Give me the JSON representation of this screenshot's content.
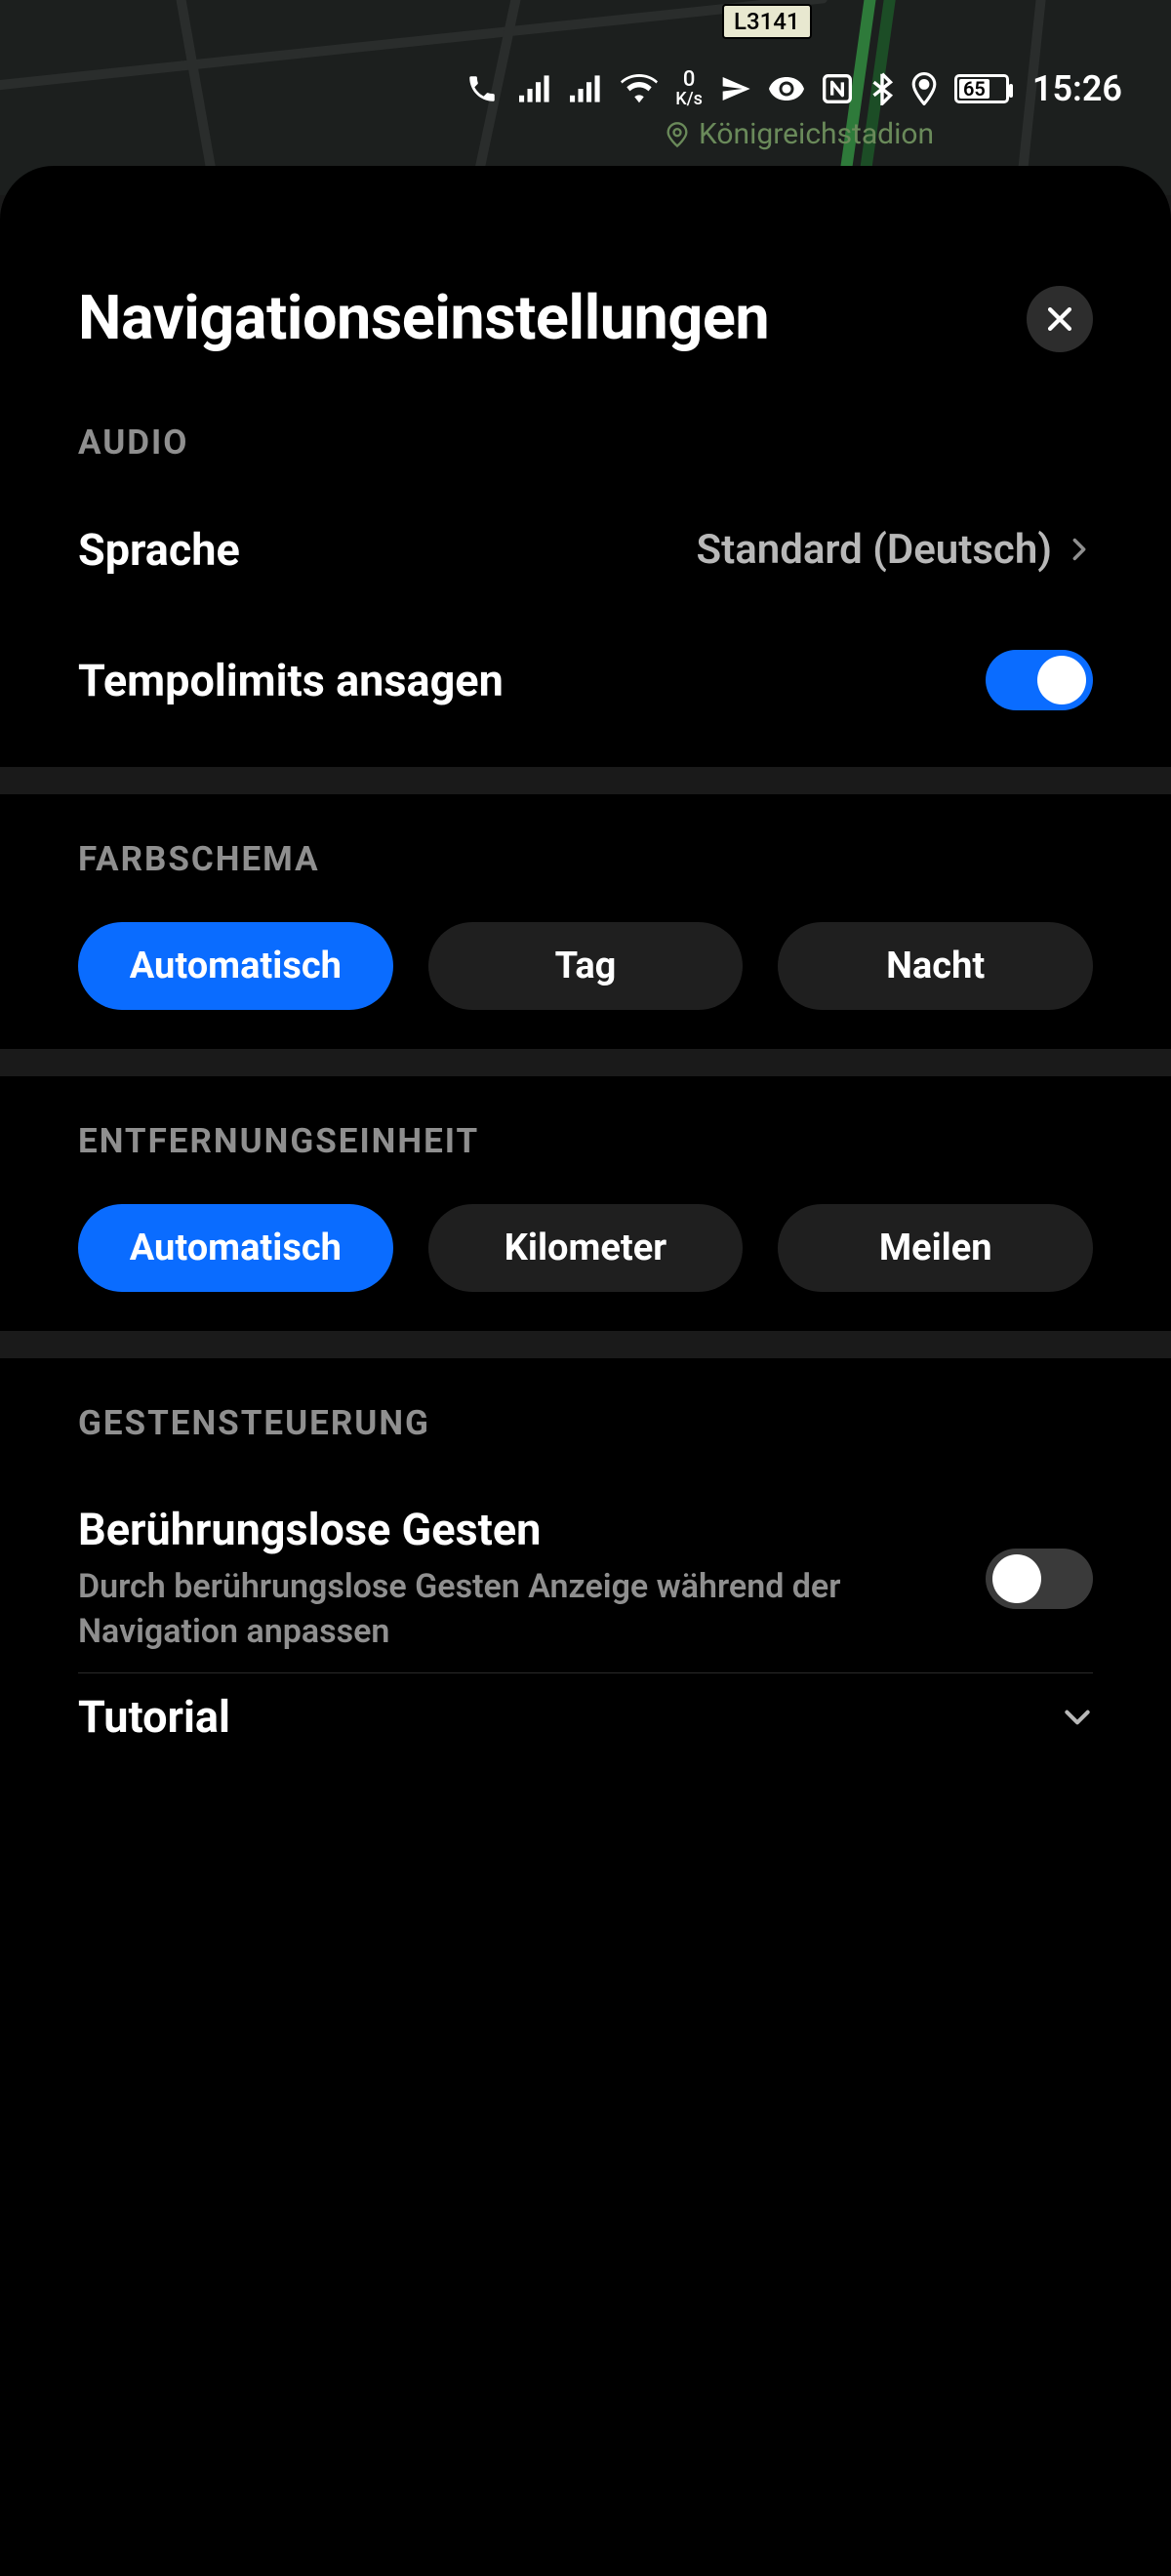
{
  "status_bar": {
    "netspeed_value": "0",
    "netspeed_unit": "K/s",
    "battery_percent": "65",
    "time": "15:26"
  },
  "map": {
    "route_sign": "L3141",
    "poi_label": "Königreichstadion"
  },
  "sheet": {
    "title": "Navigationseinstellungen"
  },
  "audio": {
    "section_label": "AUDIO",
    "language_label": "Sprache",
    "language_value": "Standard (Deutsch)",
    "speed_limits_label": "Tempolimits ansagen",
    "speed_limits_on": true
  },
  "color_scheme": {
    "section_label": "FARBSCHEMA",
    "options": [
      "Automatisch",
      "Tag",
      "Nacht"
    ],
    "selected_index": 0
  },
  "distance_unit": {
    "section_label": "ENTFERNUNGSEINHEIT",
    "options": [
      "Automatisch",
      "Kilometer",
      "Meilen"
    ],
    "selected_index": 0
  },
  "gestures": {
    "section_label": "GESTENSTEUERUNG",
    "touchless_label": "Berührungslose Gesten",
    "touchless_desc": "Durch berührungslose Gesten Anzeige während der Navigation anpassen",
    "touchless_on": false,
    "tutorial_label": "Tutorial"
  }
}
